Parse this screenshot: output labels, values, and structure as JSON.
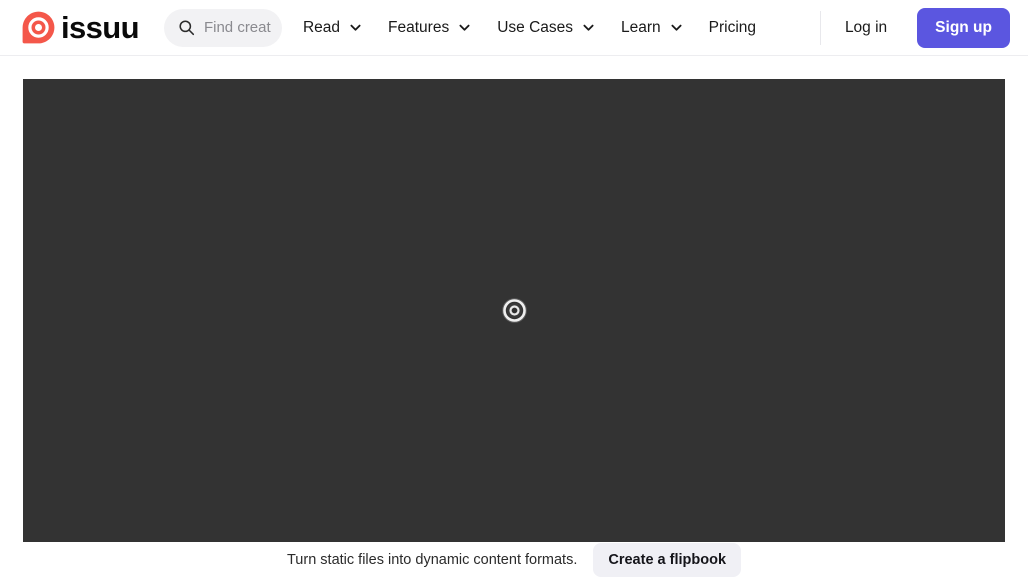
{
  "header": {
    "logo": {
      "name": "issuu",
      "mark_color": "#f4574a",
      "wordmark_color": "#0a0a0a"
    },
    "search": {
      "icon": "search-icon",
      "value": "",
      "placeholder": "Find creat"
    },
    "nav_items": [
      {
        "label": "Read",
        "has_dropdown": true,
        "icon": "chevron-down-icon"
      },
      {
        "label": "Features",
        "has_dropdown": true,
        "icon": "chevron-down-icon"
      },
      {
        "label": "Use Cases",
        "has_dropdown": true,
        "icon": "chevron-down-icon"
      },
      {
        "label": "Learn",
        "has_dropdown": true,
        "icon": "chevron-down-icon"
      },
      {
        "label": "Pricing",
        "has_dropdown": false,
        "icon": ""
      }
    ],
    "login_label": "Log in",
    "signup_label": "Sign up",
    "signup_color": "#5b56e0"
  },
  "viewer": {
    "background_color": "#333333",
    "loading_icon": "issuu-loading-spinner-icon",
    "status": ""
  },
  "bottom": {
    "promo_text": "Turn static files into dynamic content formats.",
    "cta_label": "Create a flipbook",
    "cta_background": "#f0f0f5"
  }
}
